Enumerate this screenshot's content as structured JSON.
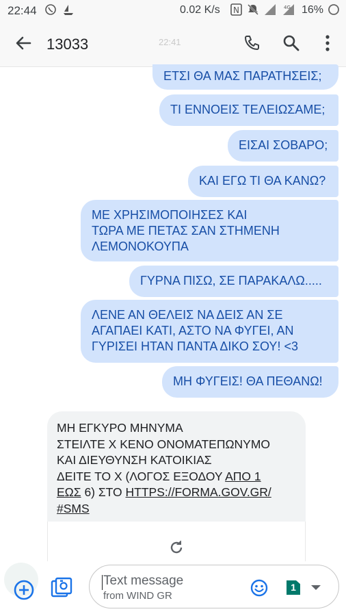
{
  "status_bar": {
    "time": "22:44",
    "network_speed": "0.02 K/s",
    "battery": "16%",
    "icons": [
      "viber-icon",
      "boat-icon",
      "nfc-icon",
      "mute-icon",
      "signal-icon",
      "4g-signal-icon",
      "battery-icon"
    ]
  },
  "app_bar": {
    "title": "13033",
    "timestamp": "22:41",
    "actions": [
      "call-icon",
      "search-icon",
      "more-icon"
    ]
  },
  "messages_out": [
    {
      "lines": [
        "ΕΤΣΙ ΘΑ ΜΑΣ ΠΑΡΑΤΗΣΕΙΣ;"
      ]
    },
    {
      "lines": [
        "ΤΙ ΕΝΝΟΕΙΣ ΤΕΛΕΙΩΣΑΜΕ;"
      ]
    },
    {
      "lines": [
        "ΕΙΣΑΙ ΣΟΒΑΡΟ;"
      ]
    },
    {
      "lines": [
        "ΚΑΙ ΕΓΩ ΤΙ ΘΑ ΚΑΝΩ?"
      ]
    },
    {
      "lines": [
        "ΜΕ ΧΡΗΣΙΜΟΠΟΙΗΣΕΣ ΚΑΙ",
        "ΤΩΡΑ ΜΕ ΠΕΤΑΣ ΣΑΝ ΣΤΗΜΕΝΗ",
        "ΛΕΜΟΝΟΚΟΥΠΑ"
      ]
    },
    {
      "lines": [
        "ΓΥΡΝΑ ΠΙΣΩ, ΣΕ ΠΑΡΑΚΑΛΩ....."
      ]
    },
    {
      "lines": [
        "ΛΕΝΕ ΑΝ ΘΕΛΕΙΣ ΝΑ ΔΕΙΣ ΑΝ ΣΕ",
        "ΑΓΑΠΑΕΙ ΚΑΤΙ, ΑΣΤΟ ΝΑ ΦΥΓΕΙ, ΑΝ",
        "ΓΥΡΙΣΕΙ ΗΤΑΝ ΠΑΝΤΑ ΔΙΚΟ ΣΟΥ! <3"
      ]
    },
    {
      "lines": [
        "ΜΗ ΦΥΓΕΙΣ! ΘΑ ΠΕΘΑΝΩ!"
      ]
    }
  ],
  "message_in": {
    "line1": "ΜΗ ΕΓΚΥΡΟ ΜΗΝΥΜΑ",
    "line2": "ΣΤΕΙΛΤΕ Χ ΚΕΝΟ ΟΝΟΜΑΤΕΠΩΝΥΜΟ",
    "line3": "ΚΑΙ ΔΙΕΥΘΥΝΣΗ ΚΑΤΟΙΚΙΑΣ",
    "line4_a": "ΔΕΙΤΕ ΤΟ Χ (ΛΟΓΟΣ ΕΞΟΔΟΥ ",
    "line4_link": "ΑΠΟ 1",
    "line5_link": "ΕΩΣ",
    "line5_b": " 6) ΣΤΟ ",
    "line5_url": "HTTPS://FORMA.GOV.GR/",
    "line6_link": "#SMS",
    "preview_icon": "refresh-icon"
  },
  "composer": {
    "placeholder": "Text message",
    "carrier": "from WIND GR",
    "sim_slot": "1",
    "icons": [
      "add-icon",
      "gallery-icon",
      "emoji-icon",
      "sim-icon",
      "dropdown-icon"
    ]
  }
}
